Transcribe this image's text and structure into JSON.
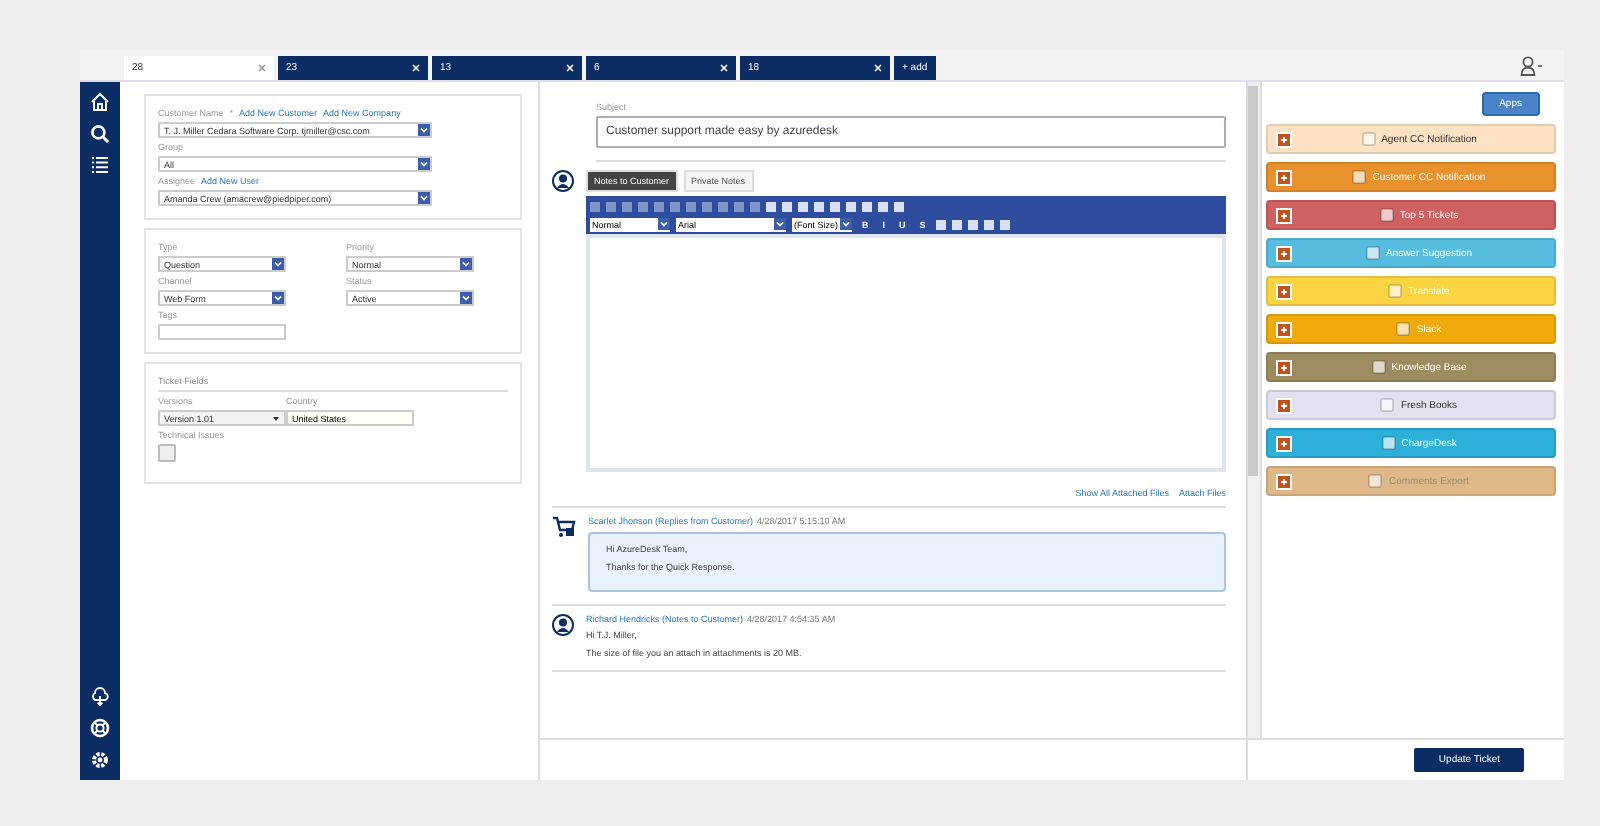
{
  "tabs": [
    {
      "label": "28",
      "selected": true
    },
    {
      "label": "23",
      "selected": false
    },
    {
      "label": "13",
      "selected": false
    },
    {
      "label": "6",
      "selected": false
    },
    {
      "label": "18",
      "selected": false
    }
  ],
  "add_tab": "+ add",
  "customer_panel": {
    "customer_label": "Customer Name",
    "required_mark": "*",
    "links": [
      "Add New Customer",
      "Add New Company"
    ],
    "customer": "T. J. Miller Cedara Software Corp. tjmiller@csc.com",
    "group_label": "Group",
    "group": "All",
    "assignee_label": "Assignee",
    "assignee_link": "Add New User",
    "assignee": "Amanda Crew (amacrew@piedpiper.com)"
  },
  "ticket_panel": {
    "type_label": "Type",
    "type": "Question",
    "priority_label": "Priority",
    "priority": "Normal",
    "channel_label": "Channel",
    "channel": "Web Form",
    "status_label": "Status",
    "status": "Active",
    "tags_label": "Tags"
  },
  "ticket_fields": {
    "title": "Ticket Fields",
    "versions_label": "Versions",
    "version": "Version 1.01",
    "country_label": "Country",
    "country": "United States",
    "technical_label": "Technical Issues",
    "technical_checked": false
  },
  "subject": {
    "label": "Subject",
    "value": "Customer support made easy by azuredesk"
  },
  "note_tabs": [
    {
      "label": "Notes to Customer",
      "selected": true
    },
    {
      "label": "Private Notes",
      "selected": false
    }
  ],
  "editor": {
    "style": "Normal",
    "font": "Arial",
    "size": "(Font Size)",
    "format_buttons": [
      "B",
      "I",
      "U",
      "S"
    ]
  },
  "attach_links": [
    "Show All Attached Files",
    "Attach Files"
  ],
  "messages": [
    {
      "kind": "customer",
      "author": "Scarlet Jhonson (Replies from Customer)",
      "time": "4/28/2017 5:15:10 AM",
      "lines": [
        "Hi AzureDesk Team,",
        "Thanks for the Quick Response."
      ]
    },
    {
      "kind": "agent",
      "author": "Richard Hendricks (Notes to Customer)",
      "time": "4/28/2017 4:54:35 AM",
      "lines": [
        "Hi T.J. Miller,",
        "The size of file you an attach in attachments is 20 MB."
      ]
    }
  ],
  "apps_button": "Apps",
  "apps": [
    {
      "label": "Agent CC Notification",
      "color": "#fde3c4",
      "disabled": false
    },
    {
      "label": "Customer CC Notification",
      "color": "#e8912d",
      "disabled": false
    },
    {
      "label": "Top 5 Tickets",
      "color": "#cf6162",
      "disabled": false
    },
    {
      "label": "Answer Suggestion",
      "color": "#57bde0",
      "disabled": false
    },
    {
      "label": "Translate",
      "color": "#fbd444",
      "disabled": false
    },
    {
      "label": "Slack",
      "color": "#f0aa0a",
      "disabled": false
    },
    {
      "label": "Knowledge Base",
      "color": "#9c8c60",
      "disabled": false
    },
    {
      "label": "Fresh Books",
      "color": "#e3e1f0",
      "disabled": false
    },
    {
      "label": "ChargeDesk",
      "color": "#2cafd8",
      "disabled": false
    },
    {
      "label": "Comments Export",
      "color": "#deb887",
      "disabled": true
    }
  ],
  "update_button": "Update Ticket"
}
